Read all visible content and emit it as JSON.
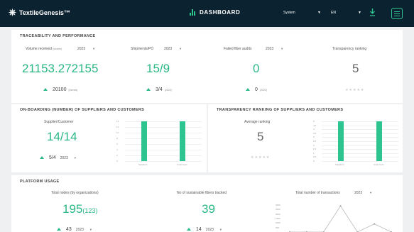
{
  "header": {
    "brand": "TextileGenesis™",
    "title": "DASHBOARD",
    "account_select": "System",
    "language_select": "EN"
  },
  "traceability": {
    "title": "TRACEABILITY AND PERFORMANCE",
    "kpis": [
      {
        "label": "Volume received",
        "unit_hint": "(tonnes)",
        "year": "2023",
        "value": "21153.272155",
        "delta": "20100",
        "delta_unit": "(tonnes)"
      },
      {
        "label": "Shipments/PO",
        "year": "2023",
        "value": "15/9",
        "delta": "3/4",
        "delta_unit": "(2022)"
      },
      {
        "label": "Failed fiber audits",
        "year": "2023",
        "value": "0",
        "delta": "0",
        "delta_unit": "(2022)"
      },
      {
        "label": "Transparency ranking",
        "value": "5",
        "stars": "★★★★★"
      }
    ]
  },
  "onboarding": {
    "title": "ON-BOARDING (NUMBER) OF SUPPLIERS AND CUSTOMERS",
    "metric_label": "Supplier/Customer",
    "value": "14/14",
    "delta": "5/4",
    "year": "2023",
    "chart_data": {
      "type": "bar",
      "categories": [
        "Suppliers",
        "Customers"
      ],
      "values": [
        14,
        14
      ],
      "ylim": [
        0,
        14
      ],
      "yticks": [
        "14",
        "12",
        "10",
        "8",
        "6",
        "4",
        "2",
        "0"
      ]
    }
  },
  "ranking": {
    "title": "TRANSPARENCY RANKING OF SUPPLIERS AND CUSTOMERS",
    "metric_label": "Average ranking",
    "value": "5",
    "stars": "★★★★★",
    "chart_data": {
      "type": "bar",
      "categories": [
        "Suppliers",
        "Customers"
      ],
      "values": [
        5,
        5
      ],
      "ylim": [
        0,
        5
      ],
      "yticks": [
        "5",
        "4.5",
        "4",
        "3.5",
        "3",
        "2.5",
        "2",
        "1.5",
        "1",
        "0.5",
        "0"
      ]
    }
  },
  "platform": {
    "title": "PLATFORM USAGE",
    "kpis": [
      {
        "label": "Total nodes (by organizations)",
        "value": "195",
        "value_sub": "(123)",
        "delta": "43",
        "year": "2023"
      },
      {
        "label": "No of sustainable fibers tracked",
        "value": "39",
        "delta": "14",
        "year": "2023"
      }
    ],
    "transactions_label": "Total number of transactions",
    "transactions_year": "2023",
    "chart_data": {
      "type": "line",
      "x": [
        "1",
        "2",
        "3",
        "4",
        "5",
        "6",
        "7"
      ],
      "values": [
        0,
        0,
        0,
        2900,
        0,
        900,
        0
      ],
      "ylim": [
        0,
        3000
      ],
      "yticks": [
        "3000",
        "2500",
        "2000",
        "1500",
        "1000",
        "500"
      ]
    }
  }
}
